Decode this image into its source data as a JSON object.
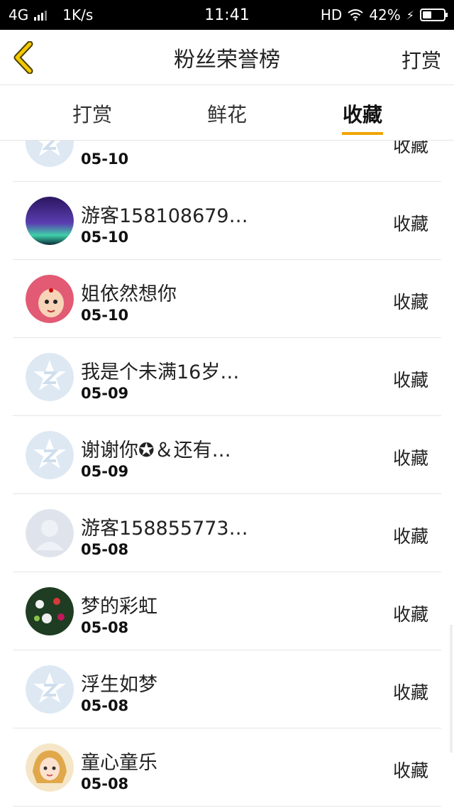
{
  "status_bar": {
    "network": "4G",
    "speed": "1K/s",
    "time": "11:41",
    "hd": "HD",
    "battery": "42%",
    "battery_level": 0.42
  },
  "header": {
    "title": "粉丝荣誉榜",
    "right_action": "打赏"
  },
  "tabs": [
    {
      "label": "打赏",
      "active": false
    },
    {
      "label": "鲜花",
      "active": false
    },
    {
      "label": "收藏",
      "active": true
    }
  ],
  "list": [
    {
      "name": "",
      "date": "05-10",
      "action": "收藏",
      "avatar": "default-q-avatar"
    },
    {
      "name": "游客158108679…",
      "date": "05-10",
      "action": "收藏",
      "avatar": "aurora-avatar"
    },
    {
      "name": "姐依然想你",
      "date": "05-10",
      "action": "收藏",
      "avatar": "cartoon-girl-avatar"
    },
    {
      "name": "我是个未满16岁…",
      "date": "05-09",
      "action": "收藏",
      "avatar": "default-q-avatar"
    },
    {
      "name": "谢谢你✪＆还有…",
      "date": "05-09",
      "action": "收藏",
      "avatar": "default-q-avatar"
    },
    {
      "name": "游客158855773…",
      "date": "05-08",
      "action": "收藏",
      "avatar": "default-person-avatar"
    },
    {
      "name": "梦的彩虹",
      "date": "05-08",
      "action": "收藏",
      "avatar": "flowers-avatar"
    },
    {
      "name": "浮生如梦",
      "date": "05-08",
      "action": "收藏",
      "avatar": "default-q-avatar"
    },
    {
      "name": "童心童乐",
      "date": "05-08",
      "action": "收藏",
      "avatar": "anime-girl-avatar"
    }
  ],
  "colors": {
    "accent": "#f0a500",
    "divider": "#e5e5e5"
  }
}
